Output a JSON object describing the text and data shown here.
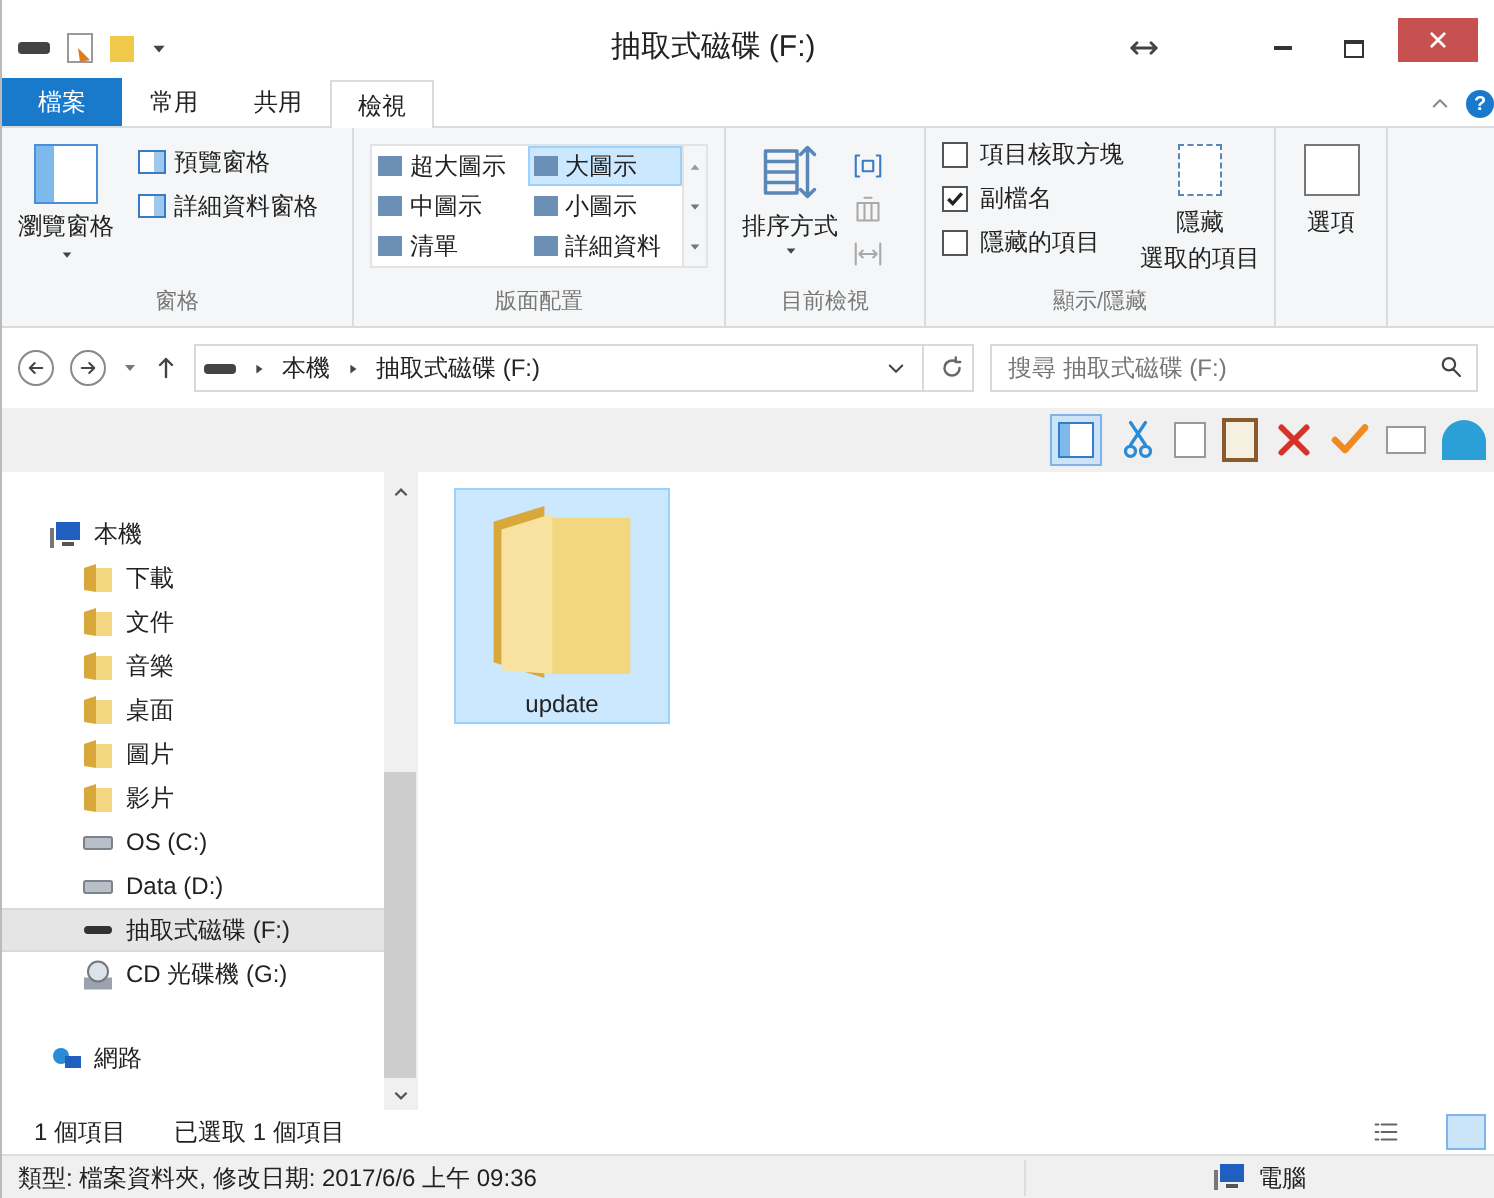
{
  "window": {
    "title": "抽取式磁碟 (F:)",
    "help": "?"
  },
  "ribbon_tabs": [
    {
      "label": "檔案",
      "kind": "file",
      "selected": false
    },
    {
      "label": "常用",
      "kind": "tab",
      "selected": false
    },
    {
      "label": "共用",
      "kind": "tab",
      "selected": false
    },
    {
      "label": "檢視",
      "kind": "tab",
      "selected": true
    }
  ],
  "ribbon": {
    "panes": {
      "large": "瀏覽窗格",
      "small": [
        "預覽窗格",
        "詳細資料窗格"
      ],
      "group": "窗格"
    },
    "layout": {
      "items": [
        {
          "label": "超大圖示",
          "selected": false
        },
        {
          "label": "大圖示",
          "selected": true
        },
        {
          "label": "中圖示",
          "selected": false
        },
        {
          "label": "小圖示",
          "selected": false
        },
        {
          "label": "清單",
          "selected": false
        },
        {
          "label": "詳細資料",
          "selected": false
        }
      ],
      "group": "版面配置"
    },
    "current_view": {
      "sort": "排序方式",
      "group": "目前檢視"
    },
    "show_hide": {
      "checkboxes": [
        {
          "label": "項目核取方塊",
          "checked": false
        },
        {
          "label": "副檔名",
          "checked": true
        },
        {
          "label": "隱藏的項目",
          "checked": false
        }
      ],
      "hide_button": [
        "隱藏",
        "選取的項目"
      ],
      "group": "顯示/隱藏"
    },
    "options": "選項"
  },
  "address": {
    "path": [
      "本機",
      "抽取式磁碟 (F:)"
    ],
    "search_placeholder": "搜尋 抽取式磁碟 (F:)"
  },
  "nav_tree": [
    {
      "label": "本機",
      "kind": "pc",
      "selected": false,
      "children": [
        {
          "label": "下載",
          "kind": "folder",
          "selected": false
        },
        {
          "label": "文件",
          "kind": "folder",
          "selected": false
        },
        {
          "label": "音樂",
          "kind": "folder",
          "selected": false
        },
        {
          "label": "桌面",
          "kind": "folder",
          "selected": false
        },
        {
          "label": "圖片",
          "kind": "folder",
          "selected": false
        },
        {
          "label": "影片",
          "kind": "folder",
          "selected": false
        },
        {
          "label": "OS (C:)",
          "kind": "drive",
          "selected": false
        },
        {
          "label": "Data (D:)",
          "kind": "drive",
          "selected": false
        },
        {
          "label": "抽取式磁碟 (F:)",
          "kind": "usb",
          "selected": true
        },
        {
          "label": "CD 光碟機 (G:)",
          "kind": "cd",
          "selected": false
        }
      ]
    },
    {
      "label": "網路",
      "kind": "network",
      "selected": false
    }
  ],
  "files": [
    {
      "name": "update",
      "selected": true
    }
  ],
  "status": {
    "count": "1 個項目",
    "selected_count": "已選取 1 個項目"
  },
  "details_bar": {
    "text": "類型: 檔案資料夾, 修改日期: 2017/6/6 上午 09:36",
    "location": "電腦"
  }
}
